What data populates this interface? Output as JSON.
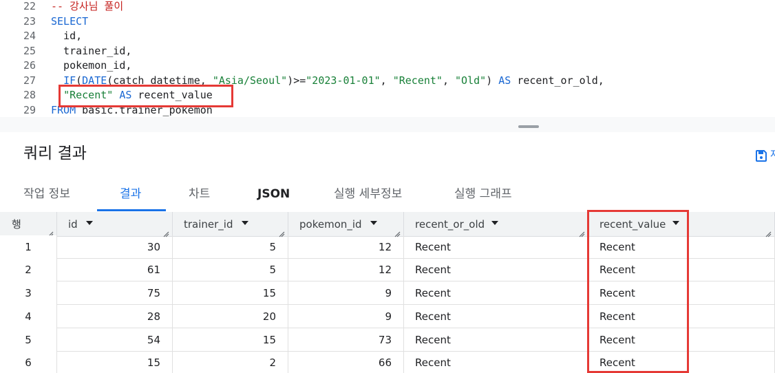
{
  "editor": {
    "lines": [
      {
        "n": "22",
        "parts": [
          {
            "t": "-- 강사님 풀이",
            "c": "cmt"
          }
        ]
      },
      {
        "n": "23",
        "parts": [
          {
            "t": "SELECT",
            "c": "kw"
          }
        ]
      },
      {
        "n": "24",
        "parts": [
          {
            "t": "  id,",
            "c": ""
          }
        ]
      },
      {
        "n": "25",
        "parts": [
          {
            "t": "  trainer_id,",
            "c": ""
          }
        ]
      },
      {
        "n": "26",
        "parts": [
          {
            "t": "  pokemon_id,",
            "c": ""
          }
        ]
      },
      {
        "n": "27",
        "parts": [
          {
            "t": "  ",
            "c": ""
          },
          {
            "t": "IF",
            "c": "kw"
          },
          {
            "t": "(",
            "c": ""
          },
          {
            "t": "DATE",
            "c": "kw"
          },
          {
            "t": "(catch_datetime, ",
            "c": ""
          },
          {
            "t": "\"Asia/Seoul\"",
            "c": "str"
          },
          {
            "t": ")>=",
            "c": ""
          },
          {
            "t": "\"2023-01-01\"",
            "c": "str"
          },
          {
            "t": ", ",
            "c": ""
          },
          {
            "t": "\"Recent\"",
            "c": "str"
          },
          {
            "t": ", ",
            "c": ""
          },
          {
            "t": "\"Old\"",
            "c": "str"
          },
          {
            "t": ") ",
            "c": ""
          },
          {
            "t": "AS",
            "c": "kw"
          },
          {
            "t": " recent_or_old,",
            "c": ""
          }
        ]
      },
      {
        "n": "28",
        "parts": [
          {
            "t": "  ",
            "c": ""
          },
          {
            "t": "\"Recent\"",
            "c": "str"
          },
          {
            "t": " ",
            "c": ""
          },
          {
            "t": "AS",
            "c": "kw"
          },
          {
            "t": " recent_value",
            "c": ""
          }
        ]
      },
      {
        "n": "29",
        "parts": [
          {
            "t": "FROM",
            "c": "kw"
          },
          {
            "t": " basic.trainer_pokemon",
            "c": ""
          }
        ]
      }
    ]
  },
  "results": {
    "title": "쿼리 결과",
    "save_icon": "save-icon",
    "save_extra": "저"
  },
  "tabs": [
    {
      "label": "작업 정보",
      "active": false
    },
    {
      "label": "결과",
      "active": true
    },
    {
      "label": "차트",
      "active": false
    },
    {
      "label": "JSON",
      "active": false
    },
    {
      "label": "실행 세부정보",
      "active": false
    },
    {
      "label": "실행 그래프",
      "active": false
    }
  ],
  "table": {
    "row_header": "행",
    "columns": [
      "id",
      "trainer_id",
      "pokemon_id",
      "recent_or_old",
      "recent_value"
    ],
    "rows": [
      [
        "1",
        "30",
        "5",
        "12",
        "Recent",
        "Recent"
      ],
      [
        "2",
        "61",
        "5",
        "12",
        "Recent",
        "Recent"
      ],
      [
        "3",
        "75",
        "15",
        "9",
        "Recent",
        "Recent"
      ],
      [
        "4",
        "28",
        "20",
        "9",
        "Recent",
        "Recent"
      ],
      [
        "5",
        "54",
        "15",
        "73",
        "Recent",
        "Recent"
      ],
      [
        "6",
        "15",
        "2",
        "66",
        "Recent",
        "Recent"
      ]
    ]
  },
  "colors": {
    "keyword": "#1967d2",
    "string": "#188038",
    "comment": "#c5221f",
    "accent": "#1a73e8",
    "highlight_box": "#e53935"
  }
}
